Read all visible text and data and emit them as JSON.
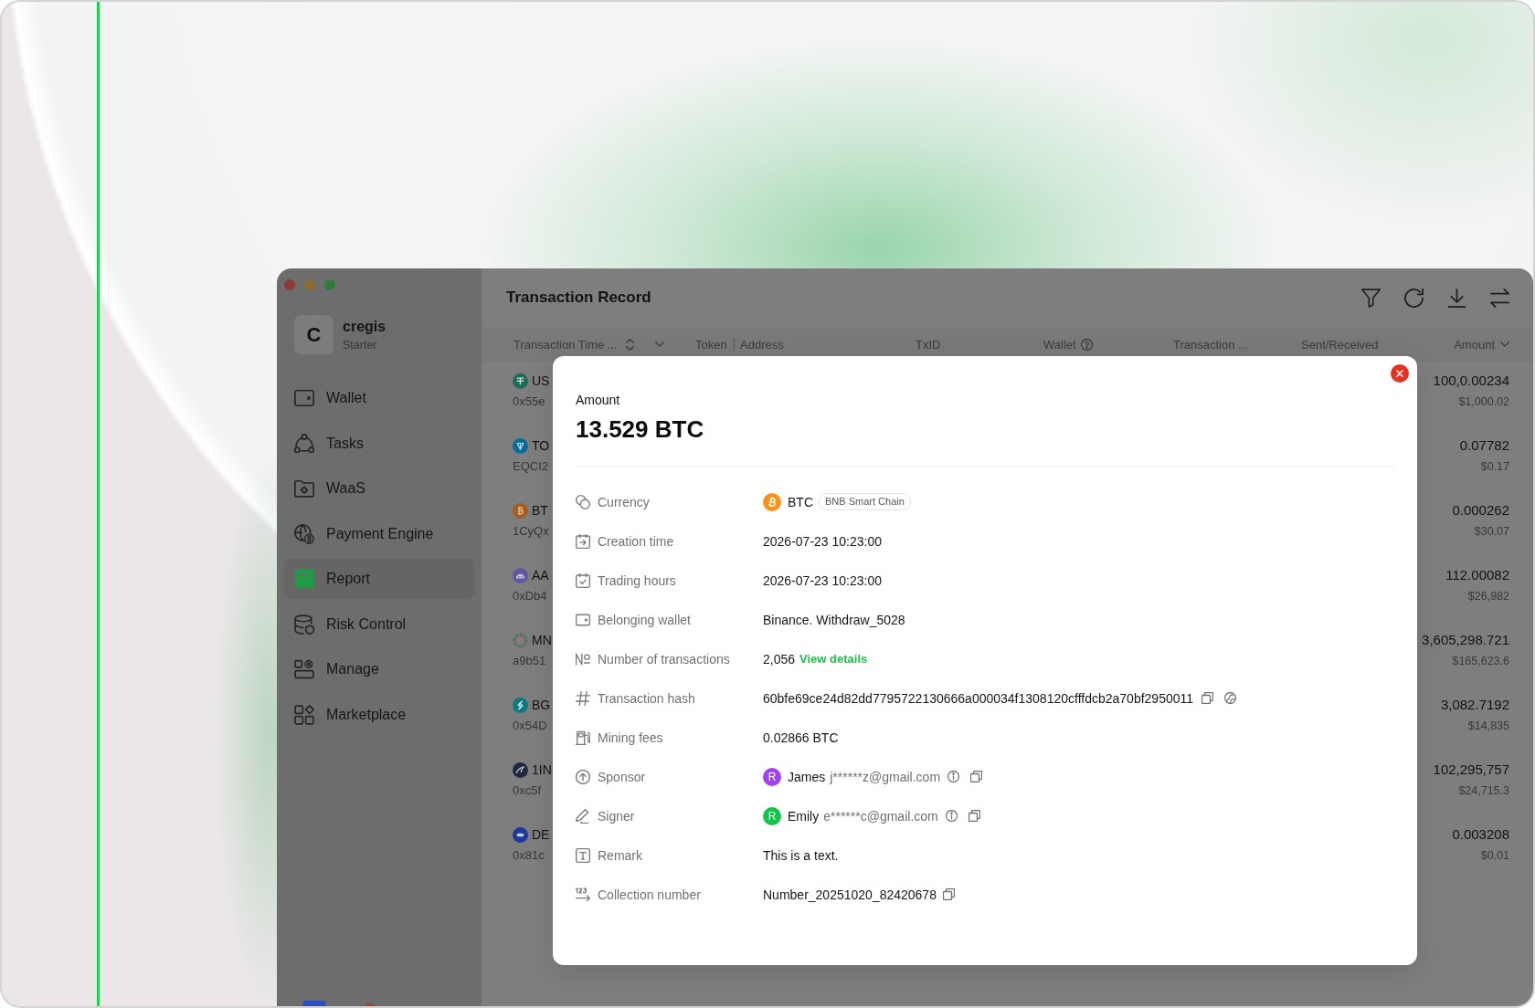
{
  "sidebar": {
    "workspace": {
      "initial": "C",
      "name": "cregis",
      "plan": "Starter"
    },
    "items": [
      {
        "label": "Wallet",
        "selected": false
      },
      {
        "label": "Tasks",
        "selected": false
      },
      {
        "label": "WaaS",
        "selected": false
      },
      {
        "label": "Payment Engine",
        "selected": false
      },
      {
        "label": "Report",
        "selected": true
      },
      {
        "label": "Risk Control",
        "selected": false
      },
      {
        "label": "Manage",
        "selected": false
      },
      {
        "label": "Marketplace",
        "selected": false
      }
    ]
  },
  "page": {
    "title": "Transaction Record"
  },
  "table": {
    "columns": [
      {
        "label": "Transaction Time ...",
        "kind": "sort_menu"
      },
      {
        "label": "Token",
        "kind": "plain"
      },
      {
        "label": "Address",
        "kind": "divided"
      },
      {
        "label": "TxID",
        "kind": "plain"
      },
      {
        "label": "Wallet",
        "kind": "help"
      },
      {
        "label": "Transaction ...",
        "kind": "plain"
      },
      {
        "label": "Sent/Received",
        "kind": "plain"
      },
      {
        "label": "Amount",
        "kind": "menu"
      }
    ],
    "rows": [
      {
        "token": "US",
        "address": "0x55e",
        "amount": "100,0.00234",
        "amount_usd": "$1,000.02"
      },
      {
        "token": "TO",
        "address": "EQCI2",
        "amount": "0.07782",
        "amount_usd": "$0.17"
      },
      {
        "token": "BT",
        "address": "1CyQx",
        "amount": "0.000262",
        "amount_usd": "$30.07"
      },
      {
        "token": "AA",
        "address": "0xDb4",
        "amount": "112.00082",
        "amount_usd": "$26,982"
      },
      {
        "token": "MN",
        "address": "a9b51",
        "amount": "3,605,298.721",
        "amount_usd": "$165,623.6"
      },
      {
        "token": "BG",
        "address": "0x54D",
        "amount": "3,082.7192",
        "amount_usd": "$14,835"
      },
      {
        "token": "1IN",
        "address": "0xc5f",
        "amount": "102,295,757",
        "amount_usd": "$24,715.3"
      },
      {
        "token": "DE",
        "address": "0x81c",
        "amount": "0.003208",
        "amount_usd": "$0.01"
      }
    ]
  },
  "dialog": {
    "amount_label": "Amount",
    "amount": "13.529 BTC",
    "fields": [
      {
        "label": "Currency",
        "kind": "currency",
        "value": "BTC",
        "chain": "BNB Smart Chain"
      },
      {
        "label": "Creation time",
        "kind": "text",
        "value": "2026-07-23 10:23:00"
      },
      {
        "label": "Trading hours",
        "kind": "text",
        "value": "2026-07-23 10:23:00"
      },
      {
        "label": "Belonging wallet",
        "kind": "text",
        "value": "Binance. Withdraw_5028"
      },
      {
        "label": "Number of transactions",
        "kind": "count",
        "value": "2,056",
        "link": "View details"
      },
      {
        "label": "Transaction hash",
        "kind": "hash",
        "value": "60bfe69ce24d82dd7795722130666a000034f1308120cfffdcb2a70bf2950011"
      },
      {
        "label": "Mining fees",
        "kind": "text",
        "value": "0.02866 BTC"
      },
      {
        "label": "Sponsor",
        "kind": "person",
        "initial": "R",
        "color": "#a43ff2",
        "name": "James",
        "email": "j******z@gmail.com"
      },
      {
        "label": "Signer",
        "kind": "person",
        "initial": "R",
        "color": "#14c34c",
        "name": "Emily",
        "email": "e******c@gmail.com"
      },
      {
        "label": "Remark",
        "kind": "text",
        "value": "This is a text."
      },
      {
        "label": "Collection number",
        "kind": "copyable",
        "value": "Number_20251020_82420678"
      }
    ]
  }
}
